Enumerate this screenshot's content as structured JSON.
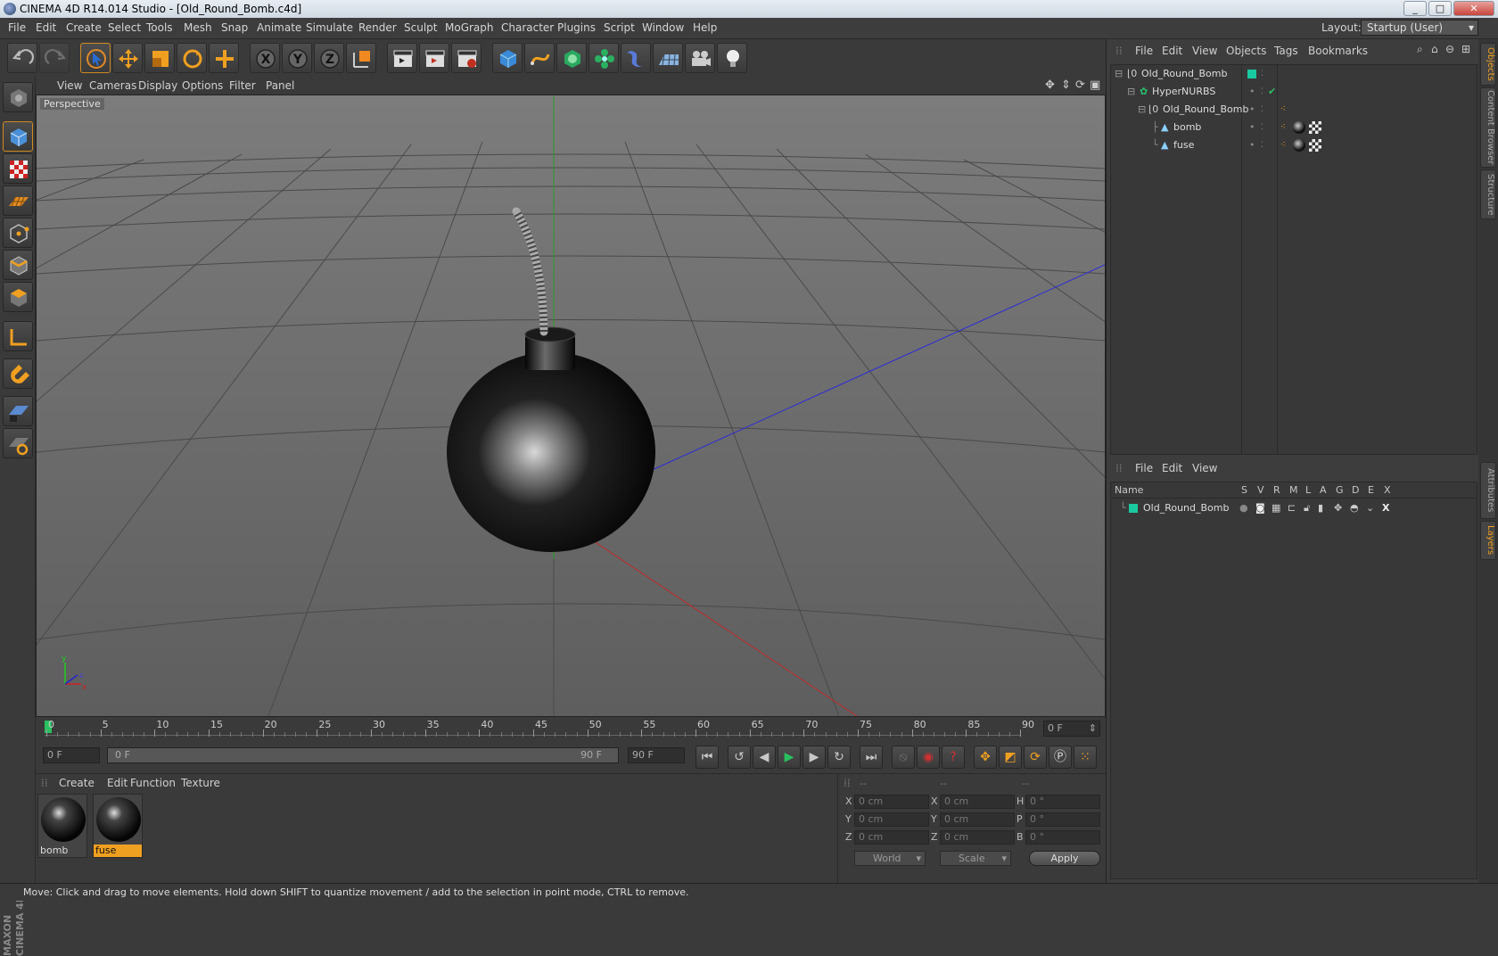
{
  "window": {
    "title": "CINEMA 4D R14.014 Studio - [Old_Round_Bomb.c4d]",
    "controls": [
      "_",
      "□",
      "✕"
    ]
  },
  "menubar": {
    "items": [
      "File",
      "Edit",
      "Create",
      "Select",
      "Tools",
      "Mesh",
      "Snap",
      "Animate",
      "Simulate",
      "Render",
      "Sculpt",
      "MoGraph",
      "Character",
      "Plugins",
      "Script",
      "Window",
      "Help"
    ],
    "layout_label": "Layout:",
    "layout_value": "Startup (User)"
  },
  "viewport": {
    "menu": [
      "View",
      "Cameras",
      "Display",
      "Options",
      "Filter",
      "Panel"
    ],
    "label": "Perspective",
    "axis_x": "x",
    "axis_y": "y",
    "axis_z": "z"
  },
  "timeline": {
    "ticks": [
      "0",
      "5",
      "10",
      "15",
      "20",
      "25",
      "30",
      "35",
      "40",
      "45",
      "50",
      "55",
      "60",
      "65",
      "70",
      "75",
      "80",
      "85",
      "90"
    ],
    "current_frame": "0 F"
  },
  "playbar": {
    "start_field": "0 F",
    "range_start": "0 F",
    "range_end": "90 F",
    "end_field": "90 F"
  },
  "material_manager": {
    "menu": [
      "Create",
      "Edit",
      "Function",
      "Texture"
    ],
    "materials": [
      {
        "name": "bomb",
        "selected": false
      },
      {
        "name": "fuse",
        "selected": true
      }
    ]
  },
  "coordinates": {
    "headers": [
      "--",
      "--",
      "--"
    ],
    "rows": [
      {
        "pos_label": "X",
        "pos": "0 cm",
        "size_label": "X",
        "size": "0 cm",
        "rot_label": "H",
        "rot": "0 °"
      },
      {
        "pos_label": "Y",
        "pos": "0 cm",
        "size_label": "Y",
        "size": "0 cm",
        "rot_label": "P",
        "rot": "0 °"
      },
      {
        "pos_label": "Z",
        "pos": "0 cm",
        "size_label": "Z",
        "size": "0 cm",
        "rot_label": "B",
        "rot": "0 °"
      }
    ],
    "space_select": "World",
    "mode_select": "Scale",
    "apply_label": "Apply"
  },
  "object_manager": {
    "menu": [
      "File",
      "Edit",
      "View",
      "Objects",
      "Tags",
      "Bookmarks"
    ],
    "objects": [
      {
        "name": "Old_Round_Bomb"
      },
      {
        "name": "HyperNURBS"
      },
      {
        "name": "Old_Round_Bomb"
      },
      {
        "name": "bomb"
      },
      {
        "name": "fuse"
      }
    ]
  },
  "layer_manager": {
    "menu": [
      "File",
      "Edit",
      "View"
    ],
    "columns": [
      "Name",
      "S",
      "V",
      "R",
      "M",
      "L",
      "A",
      "G",
      "D",
      "E",
      "X"
    ],
    "layers": [
      {
        "name": "Old_Round_Bomb",
        "color": "#19c9a0"
      }
    ]
  },
  "side_tabs": [
    "Objects",
    "Content Browser",
    "Structure",
    "Attributes",
    "Layers"
  ],
  "brand": {
    "logo": "MAXON CINEMA 4D"
  },
  "status": {
    "text": "Move: Click and drag to move elements. Hold down SHIFT to quantize movement / add to the selection in point mode, CTRL to remove."
  },
  "colors": {
    "accent": "#f0a020",
    "layer_green": "#19c9a0"
  }
}
